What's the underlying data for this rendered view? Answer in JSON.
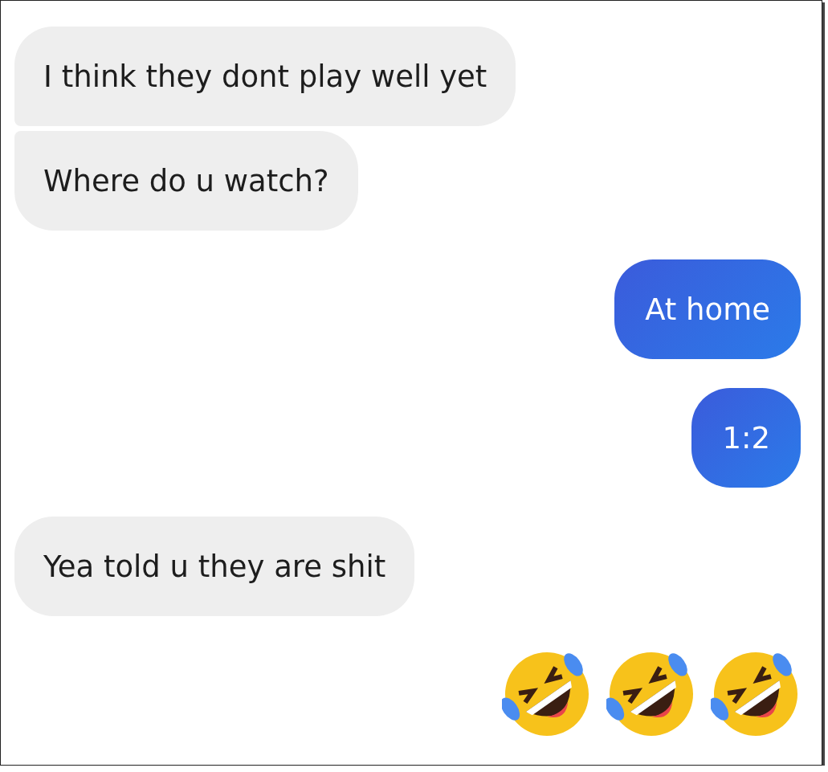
{
  "messages": [
    {
      "kind": "received",
      "text": "I think they dont play well yet",
      "joined_next": true,
      "joined_prev": false
    },
    {
      "kind": "received",
      "text": "Where do u watch?",
      "joined_next": false,
      "joined_prev": true
    },
    {
      "kind": "sent",
      "text": "At home",
      "joined_next": false,
      "joined_prev": false
    },
    {
      "kind": "sent",
      "text": "1:2",
      "joined_next": false,
      "joined_prev": false
    },
    {
      "kind": "received",
      "text": "Yea told u they are shit",
      "joined_next": false,
      "joined_prev": false
    },
    {
      "kind": "emoji"
    },
    {
      "kind": "emoji"
    },
    {
      "kind": "emoji"
    }
  ]
}
